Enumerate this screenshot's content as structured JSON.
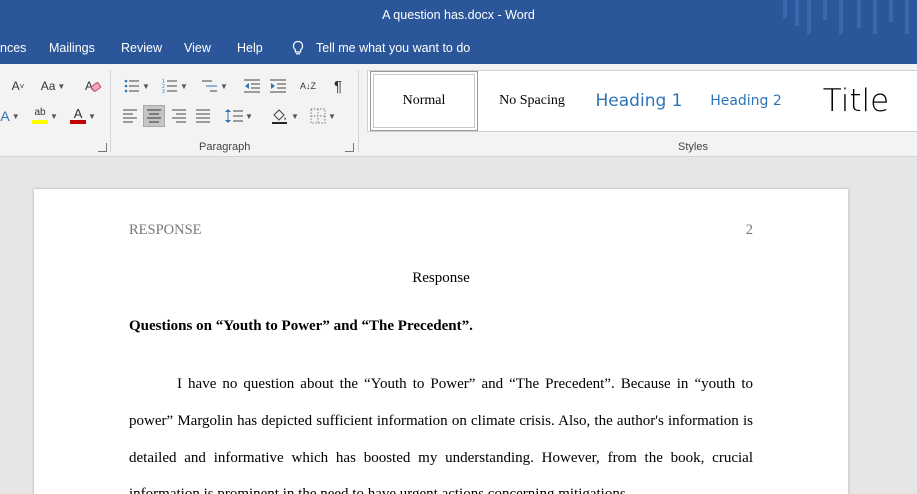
{
  "window": {
    "title": "A question has.docx  -  Word"
  },
  "tabs": {
    "references": "nces",
    "mailings": "Mailings",
    "review": "Review",
    "view": "View",
    "help": "Help",
    "tell_me": "Tell me what you want to do"
  },
  "ribbon": {
    "paragraph_label": "Paragraph",
    "styles_label": "Styles",
    "font_size_glyph": "A",
    "change_case_glyph": "Aa",
    "sort_glyph": "A↓Z",
    "pilcrow_glyph": "¶",
    "highlight_glyph": "ab",
    "font_color_glyph": "A",
    "highlight_color": "#ffff00",
    "font_color": "#c00000"
  },
  "styles": {
    "normal": "Normal",
    "no_spacing": "No Spacing",
    "heading1": "Heading 1",
    "heading2": "Heading 2",
    "title": "Title"
  },
  "document": {
    "running_head": "RESPONSE",
    "page_number": "2",
    "title": "Response",
    "heading": "Questions on “Youth to Power” and “The Precedent”.",
    "paragraph": "I have no question about the “Youth to Power” and “The Precedent”. Because in “youth to power” Margolin has depicted sufficient information on climate crisis. Also, the author's information is detailed and informative which has boosted my understanding. However, from the book, crucial information is prominent in the need to have urgent actions concerning mitigations"
  }
}
